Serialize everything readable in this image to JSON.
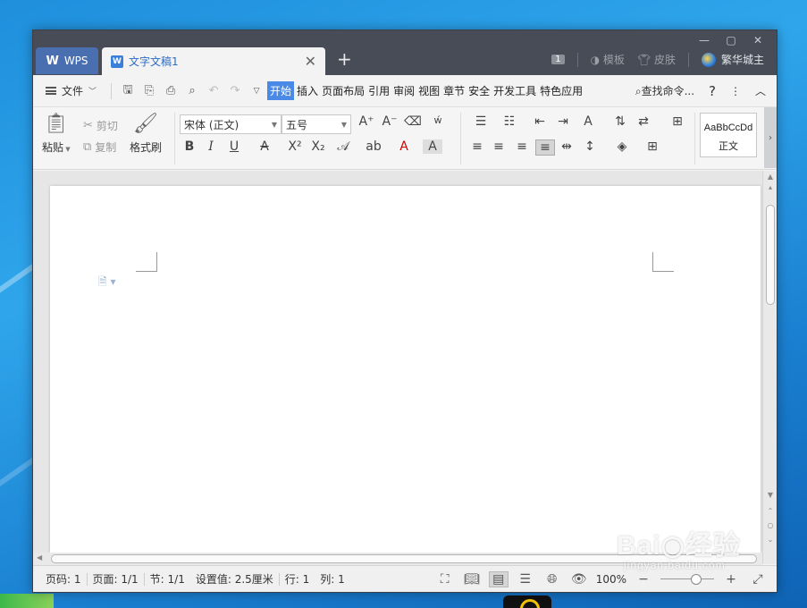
{
  "window": {
    "controls": [
      "—",
      "▢",
      "✕"
    ]
  },
  "tabs": {
    "wps_label": "WPS",
    "doc_label": "文字文稿1",
    "doc_badge": "W"
  },
  "titlebar_right": {
    "badge": "1",
    "template_label": "模板",
    "skin_label": "皮肤",
    "user_name": "繁华城主"
  },
  "menubar": {
    "file_label": "文件",
    "tabs": [
      "开始",
      "插入",
      "页面布局",
      "引用",
      "审阅",
      "视图",
      "章节",
      "安全",
      "开发工具",
      "特色应用"
    ],
    "active_tab": "开始",
    "search_label": "查找命令...",
    "help_label": "?"
  },
  "ribbon": {
    "paste_label": "粘贴",
    "cut_label": "剪切",
    "copy_label": "复制",
    "format_painter_label": "格式刷",
    "font_name": "宋体 (正文)",
    "font_size": "五号",
    "style_sample": "AaBbCcDd",
    "style_name": "正文"
  },
  "statusbar": {
    "page_num": "页码: 1",
    "pages": "页面: 1/1",
    "section": "节: 1/1",
    "setting": "设置值: 2.5厘米",
    "row": "行: 1",
    "col": "列: 1",
    "zoom": "100%"
  },
  "watermark": {
    "logo_text": "Bai◉经验",
    "sub_text": "jingyan.baidu.com"
  },
  "colors": {
    "titlebar": "#474c56",
    "accent": "#4a8ae6",
    "wps_tab": "#4a6fb0"
  }
}
